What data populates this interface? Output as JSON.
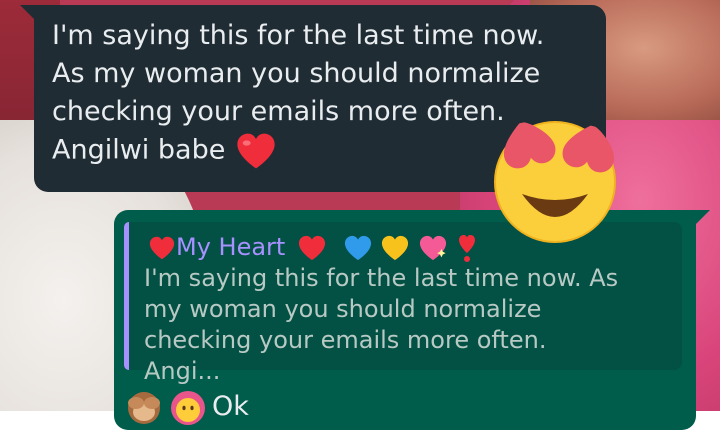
{
  "incoming_message": {
    "lines": [
      "I'm saying this for the last time now.",
      "As my woman you should normalize",
      "checking your emails more often.",
      "Angilwi babe"
    ],
    "trailing_emoji": "red-heart"
  },
  "outgoing_message": {
    "quote": {
      "author": "My Heart",
      "author_emojis": [
        "red-heart",
        "red-heart",
        "blue-heart",
        "yellow-heart",
        "sparkling-heart",
        "heart-exclamation"
      ],
      "text": "I'm saying this for the last time now. As my woman you should normalize checking your emails more often. Angi..."
    },
    "reply": {
      "emojis": [
        "see-no-evil-monkey",
        "face-in-pink-bonnet"
      ],
      "text": "Ok"
    }
  },
  "reaction_emoji": "smiling-face-with-heart-eyes",
  "colors": {
    "incoming_bubble": "#1f2c34",
    "outgoing_bubble": "#005c4b",
    "quote_bg": "#025144",
    "quote_accent": "#a791ff",
    "text": "#e9edef"
  }
}
